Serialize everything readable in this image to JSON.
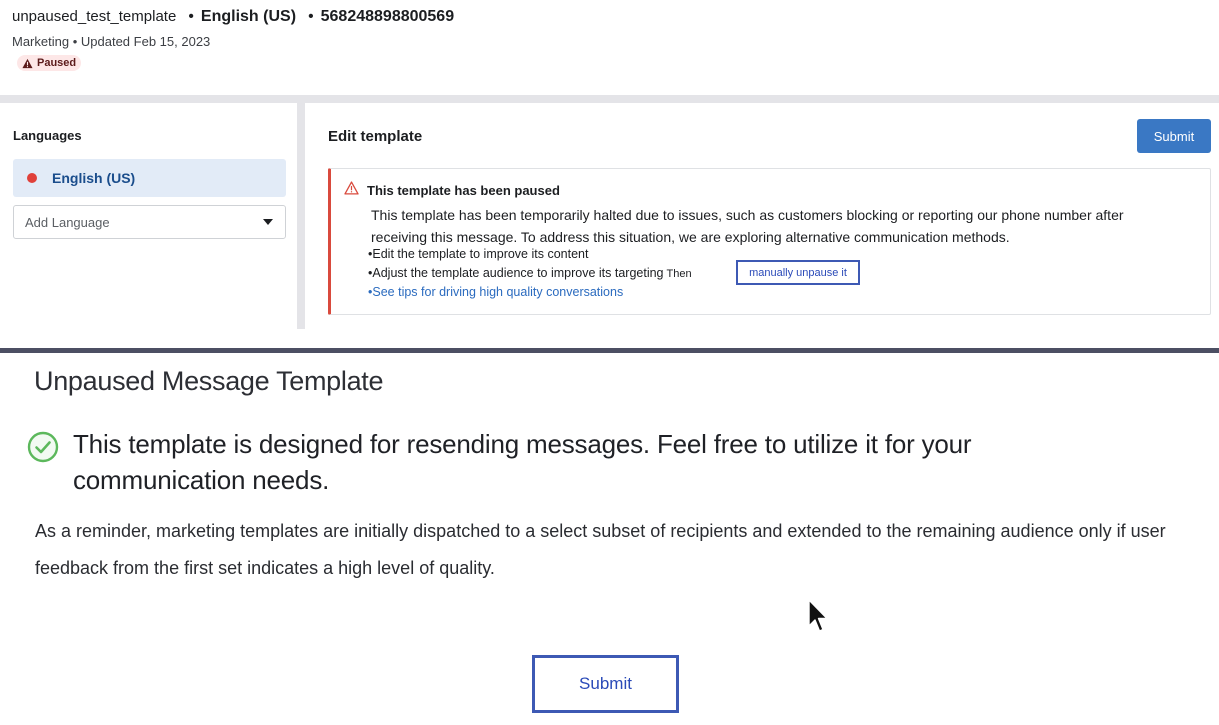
{
  "header": {
    "template_name": "unpaused_test_template",
    "sep": "•",
    "language": "English (US)",
    "template_id": "568248898800569",
    "category": "Marketing",
    "meta_sep": "•",
    "updated_label": "Updated",
    "updated_date": "Feb 15, 2023",
    "status_badge": "Paused"
  },
  "sidebar": {
    "title": "Languages",
    "selected_language": "English (US)",
    "add_language_placeholder": "Add Language"
  },
  "editor": {
    "title": "Edit template",
    "submit_label": "Submit",
    "alert": {
      "title": "This template has been paused",
      "body": "This template has been temporarily halted due to issues, such as customers blocking or reporting our phone number after receiving this message. To address this situation, we are exploring alternative communication methods.",
      "bullet_1": "•Edit the template to improve its content",
      "bullet_2": "•Adjust the template audience to improve its targeting",
      "then_text": "Then",
      "unpause_link": "manually unpause it",
      "bullet_3": "•See tips for driving high quality conversations"
    }
  },
  "confirmation": {
    "title": "Unpaused Message Template",
    "headline": "This template is designed for resending messages. Feel free to utilize it for your communication needs.",
    "reminder": "As a reminder, marketing templates are initially dispatched to a select subset of recipients and extended to the remaining audience only if user feedback from the first set indicates a high level of quality.",
    "submit_label": "Submit"
  },
  "colors": {
    "primary": "#3a78c4",
    "alert_border": "#d94a3d",
    "highlight_box": "#3d59b4",
    "success": "#5cb85c",
    "selected_bg": "#e2ebf7"
  }
}
